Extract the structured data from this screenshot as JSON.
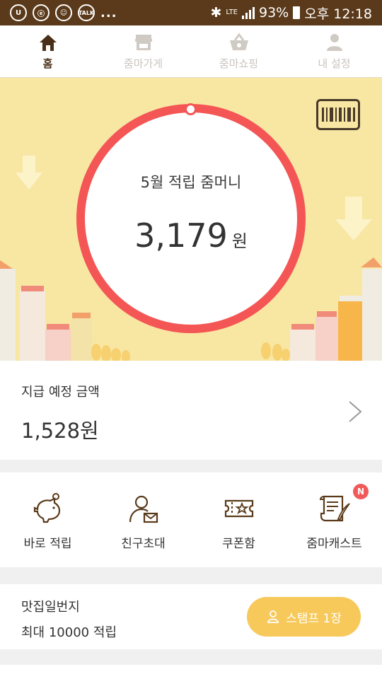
{
  "status_bar": {
    "left_icons": [
      "U",
      "ⓔ",
      "☺",
      "TALK"
    ],
    "dots": "...",
    "network": "LTE",
    "battery": "93%",
    "time": "오후 12:18"
  },
  "tabs": [
    {
      "label": "홈",
      "icon": "home-icon",
      "active": true
    },
    {
      "label": "줌마가게",
      "icon": "store-icon",
      "active": false
    },
    {
      "label": "줌마쇼핑",
      "icon": "basket-icon",
      "active": false
    },
    {
      "label": "내 설정",
      "icon": "person-icon",
      "active": false
    }
  ],
  "hero": {
    "title": "5월 적립 줌머니",
    "amount": "3,179",
    "unit": "원",
    "barcode_icon": "barcode-icon"
  },
  "pending": {
    "title": "지급 예정 금액",
    "amount": "1,528원"
  },
  "quick_menu": [
    {
      "label": "바로 적립",
      "icon": "piggy-bank-icon"
    },
    {
      "label": "친구초대",
      "icon": "invite-friend-icon"
    },
    {
      "label": "쿠폰함",
      "icon": "coupon-icon"
    },
    {
      "label": "줌마캐스트",
      "icon": "scroll-quill-icon",
      "badge": "N"
    }
  ],
  "store_card": {
    "name": "맛집일번지",
    "description": "최대 10000 적립",
    "stamp_button": "스탬프 1장"
  },
  "colors": {
    "status_bar": "#5a3a1a",
    "hero_bg": "#f8e6a3",
    "ring": "#f45555",
    "stamp_button": "#f6c95a",
    "badge": "#f05a5a"
  }
}
